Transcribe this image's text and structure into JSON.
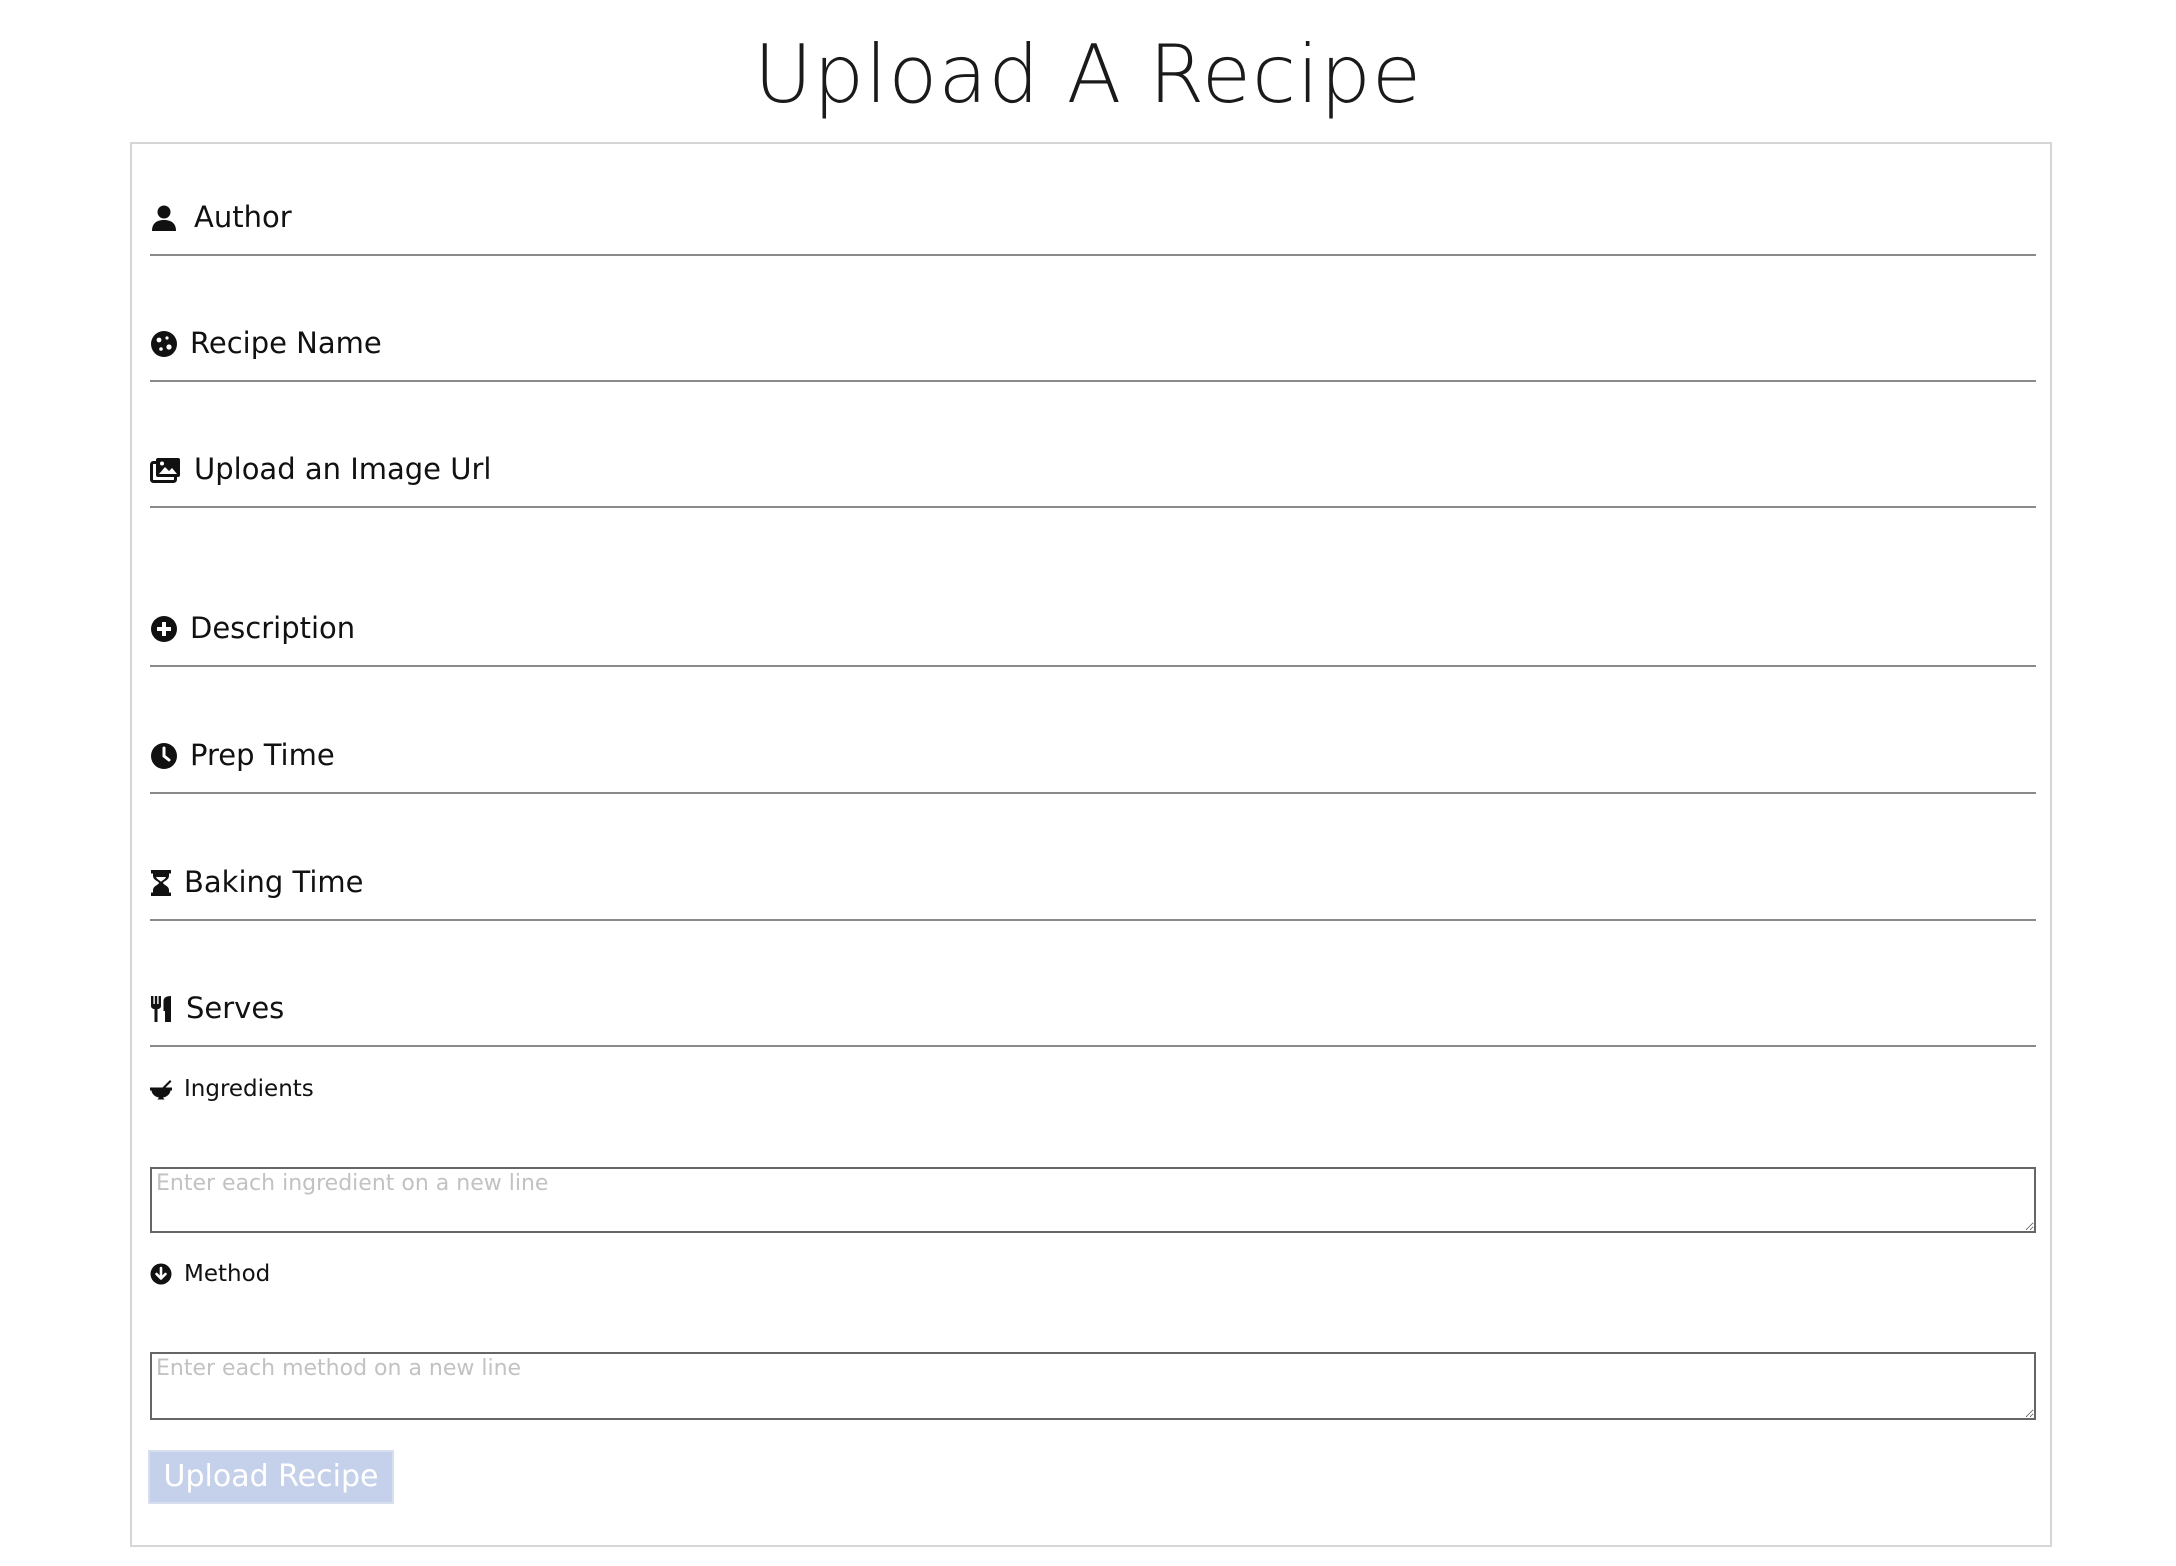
{
  "page": {
    "title": "Upload A Recipe"
  },
  "form": {
    "fields": [
      {
        "id": "author",
        "label": "Author",
        "icon": "user-icon"
      },
      {
        "id": "recipe-name",
        "label": "Recipe Name",
        "icon": "cookie-icon"
      },
      {
        "id": "image-url",
        "label": "Upload an Image Url",
        "icon": "images-icon"
      },
      {
        "id": "description",
        "label": "Description",
        "icon": "plus-circle-icon"
      },
      {
        "id": "prep-time",
        "label": "Prep Time",
        "icon": "clock-icon"
      },
      {
        "id": "baking-time",
        "label": "Baking Time",
        "icon": "hourglass-icon"
      },
      {
        "id": "serves",
        "label": "Serves",
        "icon": "utensils-icon"
      }
    ],
    "ingredients": {
      "label": "Ingredients",
      "icon": "mortar-pestle-icon",
      "placeholder": "Enter each ingredient on a new line",
      "value": ""
    },
    "method": {
      "label": "Method",
      "icon": "arrow-circle-down-icon",
      "placeholder": "Enter each method on a new line",
      "value": ""
    },
    "submit_label": "Upload Recipe"
  },
  "colors": {
    "button_bg": "#c5d1ea",
    "button_text": "#ffffff",
    "field_underline": "#8a8a8a",
    "card_border": "#d6d6d6",
    "placeholder": "#c2c2c2"
  }
}
